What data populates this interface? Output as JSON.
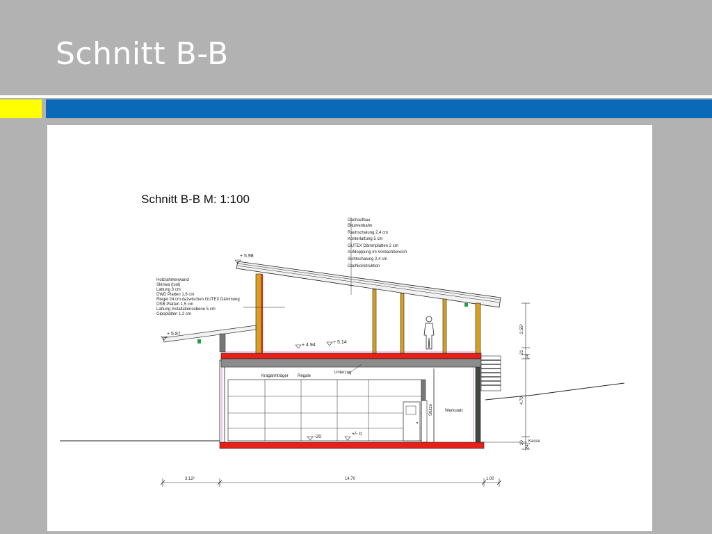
{
  "slide": {
    "title": "Schnitt B-B"
  },
  "drawing": {
    "heading": "Schnitt B-B   M:   1:100",
    "roof_layers": [
      "Dachaufbau",
      "Bitumenbahn",
      "Rauhschalung 2,4 cm",
      "Konterlattung 5 cm",
      "GUTEX Dämmplatten 2 cm",
      "Aufdopplung im Vordachbereich",
      "Sichtschalung 2,4 cm",
      "Dachkonstruktion"
    ],
    "wall_layers": [
      "Holzrahmenwand",
      "Skinwa (Isol)",
      "Lattung 3 cm",
      "DWD Platten 1,6 cm",
      "Riegel 24 cm dazwischen GUTEX Dämmung",
      "OSB Platten 1,5 cm",
      "Lattung Installationsebene 5 cm",
      "Gipsplatten 1,2 cm"
    ],
    "levels": {
      "ridge": "+ 5.98",
      "canopy": "+ 5.87",
      "upper_floor": "+ 4.94",
      "upper_floor_top": "+ 5.14",
      "lower_floor": "-20",
      "ground": "+/- 0"
    },
    "labels": {
      "cantilever": "Kragarmträger",
      "shelves": "Regale",
      "beam": "Unterzug",
      "column": "Stütze",
      "workshop": "Werkstatt",
      "section_room": "Kasse"
    },
    "vertical_dims": [
      "2.55³",
      "21",
      "24",
      "4.70",
      "20",
      "24"
    ],
    "horizontal_dims": [
      "3.12³",
      "14.70",
      "1.00"
    ]
  }
}
